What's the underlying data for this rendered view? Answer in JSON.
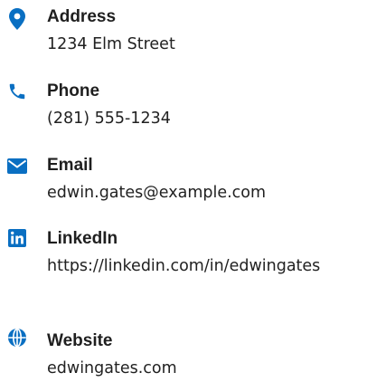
{
  "contact": {
    "accent_color": "#0a6fc2",
    "items": [
      {
        "icon": "map-marker-icon",
        "label": "Address",
        "value": "1234 Elm Street"
      },
      {
        "icon": "phone-icon",
        "label": "Phone",
        "value": "(281) 555-1234"
      },
      {
        "icon": "envelope-icon",
        "label": "Email",
        "value": "edwin.gates@example.com"
      },
      {
        "icon": "linkedin-icon",
        "label": "LinkedIn",
        "value": "https://linkedin.com/in/edwingates"
      },
      {
        "icon": "globe-icon",
        "label": "Website",
        "value": "edwingates.com"
      }
    ]
  }
}
